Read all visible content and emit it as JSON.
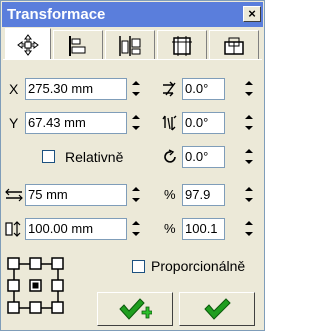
{
  "window": {
    "title": "Transformace",
    "close_label": "×"
  },
  "tabs": [
    {
      "name": "position",
      "icon": "move-arrows-icon",
      "active": true
    },
    {
      "name": "align",
      "icon": "align-left-icon",
      "active": false
    },
    {
      "name": "distribute",
      "icon": "distribute-icon",
      "active": false
    },
    {
      "name": "size",
      "icon": "size-icon",
      "active": false
    },
    {
      "name": "skew",
      "icon": "skew-icon",
      "active": false
    }
  ],
  "fields": {
    "x": {
      "label": "X",
      "value": "275.30 mm"
    },
    "y": {
      "label": "Y",
      "value": "67.43 mm"
    },
    "horizontal_skew": {
      "icon": "horizontal-skew-icon",
      "value": "0.0°"
    },
    "vertical_skew": {
      "icon": "vertical-skew-icon",
      "value": "0.0°"
    },
    "rotation": {
      "icon": "rotation-icon",
      "value": "0.0°"
    },
    "width": {
      "icon": "width-icon",
      "value": "75 mm"
    },
    "height": {
      "icon": "height-icon",
      "value": "100.00 mm"
    },
    "width_percent": {
      "label": "%",
      "value": "97.9"
    },
    "height_percent": {
      "label": "%",
      "value": "100.1"
    }
  },
  "checkboxes": {
    "relative": {
      "label": "Relativně",
      "checked": false
    },
    "proportional": {
      "label": "Proporcionálně",
      "checked": false
    }
  },
  "buttons": {
    "apply_copy": {
      "icon": "check-plus-icon"
    },
    "apply": {
      "icon": "check-icon"
    }
  },
  "colors": {
    "titlebar": "#5a7edc",
    "panel": "#ece9d8",
    "check_green": "#1f9e1f"
  }
}
